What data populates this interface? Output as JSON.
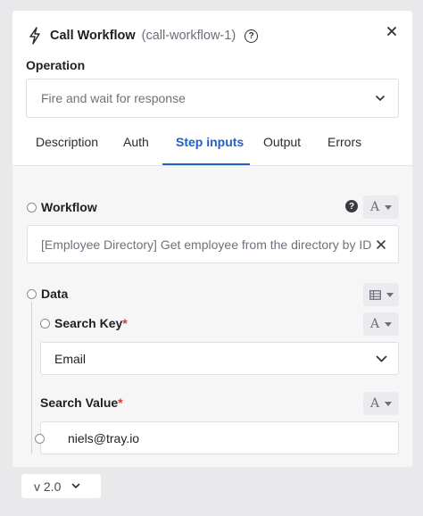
{
  "header": {
    "title": "Call Workflow",
    "subtitle": "(call-workflow-1)",
    "help_glyph": "?",
    "icons": {
      "title": "lightning-bolt-icon",
      "close": "close-icon",
      "help": "help-circle-icon"
    }
  },
  "operation": {
    "label": "Operation",
    "selected": "Fire and wait for response"
  },
  "tabs": [
    {
      "label": "Description",
      "active": false
    },
    {
      "label": "Auth",
      "active": false
    },
    {
      "label": "Step inputs",
      "active": true
    },
    {
      "label": "Output",
      "active": false
    },
    {
      "label": "Errors",
      "active": false
    }
  ],
  "workflow": {
    "label": "Workflow",
    "value": "[Employee Directory] Get employee from the directory by ID",
    "type_glyph": "A",
    "help_glyph": "?"
  },
  "data": {
    "label": "Data",
    "type_icon": "table-icon",
    "search_key": {
      "label": "Search Key",
      "required_mark": "*",
      "type_glyph": "A",
      "value": "Email"
    },
    "search_value": {
      "label": "Search Value",
      "required_mark": "*",
      "type_glyph": "A",
      "value": "niels@tray.io"
    }
  },
  "footer": {
    "version": "v 2.0"
  },
  "colors": {
    "accent": "#1f5fc7",
    "required": "#d23a3a",
    "background": "#e9e9ec"
  }
}
